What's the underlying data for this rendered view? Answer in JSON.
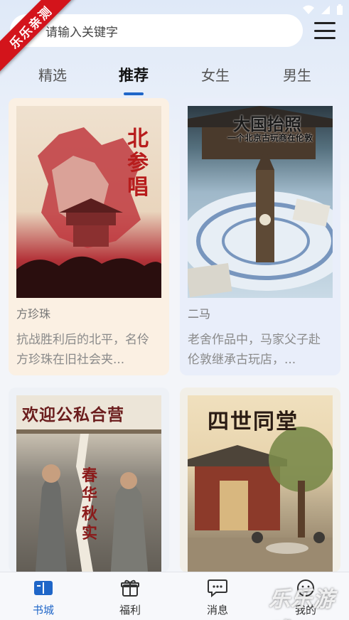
{
  "ribbon": {
    "text": "乐乐亲测"
  },
  "search": {
    "placeholder": "请输入关键字"
  },
  "tabs": [
    {
      "label": "精选",
      "active": false
    },
    {
      "label": "推荐",
      "active": true
    },
    {
      "label": "女生",
      "active": false
    },
    {
      "label": "男生",
      "active": false
    }
  ],
  "books": [
    {
      "cover_title": "北参唱",
      "author": "方珍珠",
      "desc": "抗战胜利后的北平，名伶方珍珠在旧社会夹..."
    },
    {
      "cover_title": "大国抬照",
      "cover_subtitle": "一个北京古玩商在伦敦",
      "author": "二马",
      "desc": "老舍作品中，马家父子赴伦敦继承古玩店，..."
    },
    {
      "cover_title": "欢迎公私合营",
      "cover_subtitle": "春华秋实"
    },
    {
      "cover_title": "四世同堂"
    }
  ],
  "bottom_nav": [
    {
      "label": "书城",
      "icon": "book-icon",
      "active": true
    },
    {
      "label": "福利",
      "icon": "gift-icon",
      "active": false
    },
    {
      "label": "消息",
      "icon": "message-icon",
      "active": false
    },
    {
      "label": "我的",
      "icon": "user-icon",
      "active": false
    }
  ],
  "watermark": {
    "text": "乐乐游戏"
  },
  "colors": {
    "accent": "#1f66c8",
    "ribbon": "#d3141b"
  }
}
